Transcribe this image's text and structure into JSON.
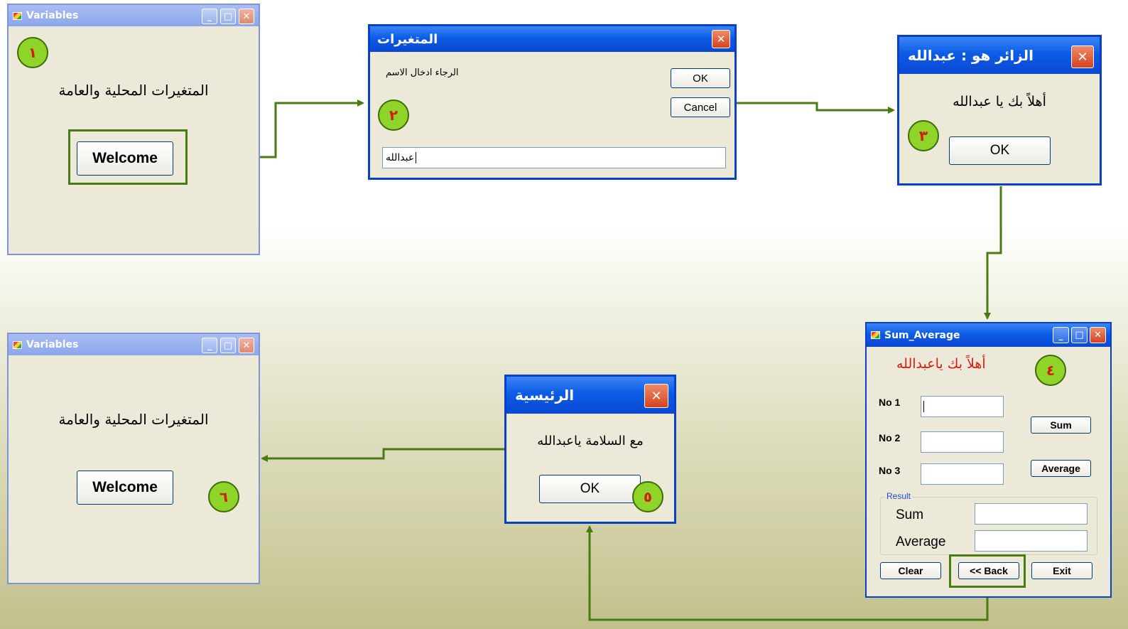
{
  "windows": {
    "w1": {
      "title": "Variables",
      "caption": "المتغيرات المحلية والعامة",
      "button": "Welcome"
    },
    "w2": {
      "title": "المتغيرات",
      "prompt": "الرجاء ادخال الاسم",
      "ok": "OK",
      "cancel": "Cancel",
      "input_value": "عبدالله"
    },
    "w3": {
      "title": "الزائر هو : عبدالله",
      "message": "أهلاً بك يا عبدالله",
      "ok": "OK"
    },
    "w4": {
      "title": "Sum_Average",
      "greeting": "أهلاً بك ياعبدالله",
      "no1": "No 1",
      "no2": "No 2",
      "no3": "No 3",
      "sum_btn": "Sum",
      "avg_btn": "Average",
      "group": "Result",
      "sum_label": "Sum",
      "avg_label": "Average",
      "clear": "Clear",
      "back": "<< Back",
      "exit": "Exit"
    },
    "w5": {
      "title": "الرئيسية",
      "message": "مع السلامة ياعبدالله",
      "ok": "OK"
    },
    "w6": {
      "title": "Variables",
      "caption": "المتغيرات المحلية والعامة",
      "button": "Welcome"
    }
  },
  "title_buttons": {
    "minimize": "_",
    "maximize": "□",
    "close": "✕"
  },
  "badges": [
    "١",
    "٢",
    "٣",
    "٤",
    "٥",
    "٦"
  ],
  "colors": {
    "arrow": "#4a7a12",
    "badge_fill": "#8fd428",
    "badge_text": "#d01e10",
    "greeting": "#d01e10",
    "xp_title": "#0d5be6"
  }
}
